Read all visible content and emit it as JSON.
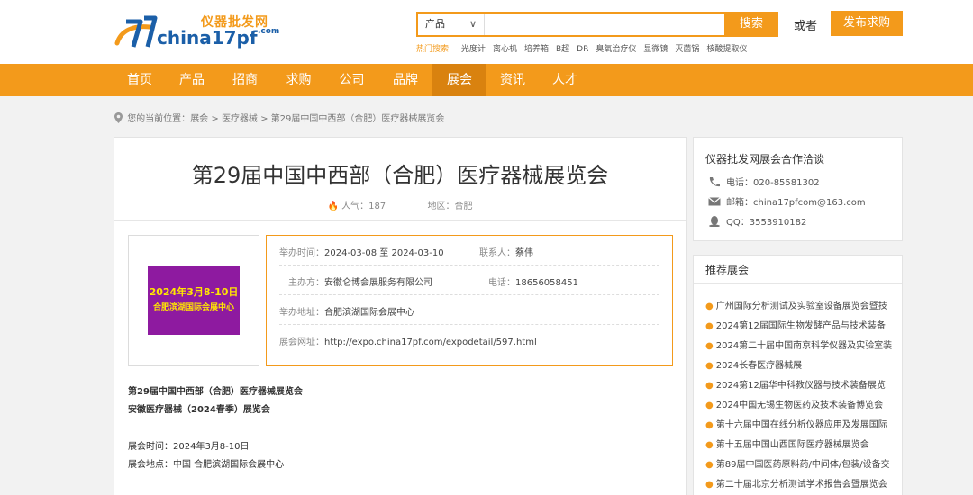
{
  "header": {
    "logo_cn": "仪器批发网",
    "logo_en": "china17pf",
    "logo_en_sub": ".com",
    "search_category": "产品",
    "search_placeholder": "",
    "search_button": "搜索",
    "hot_label": "热门搜索:",
    "hot_items": [
      "光度计",
      "离心机",
      "培养箱",
      "B超",
      "DR",
      "臭氧治疗仪",
      "显微镜",
      "灭菌锅",
      "核酸提取仪"
    ],
    "or_text": "或者",
    "publish_button": "发布求购"
  },
  "nav": {
    "items": [
      "首页",
      "产品",
      "招商",
      "求购",
      "公司",
      "品牌",
      "展会",
      "资讯",
      "人才"
    ],
    "active": "展会"
  },
  "breadcrumb": {
    "label": "您的当前位置：",
    "parts": [
      "展会",
      "医疗器械",
      "第29届中国中西部（合肥）医疗器械展览会"
    ],
    "sep": " > "
  },
  "expo": {
    "title": "第29届中国中西部（合肥）医疗器械展览会",
    "popularity_label": "人气：",
    "popularity": "187",
    "region_label": "地区：",
    "region": "合肥",
    "poster_line1": "2024年3月8-10日",
    "poster_line2": "合肥滨湖国际会展中心",
    "time_label": "举办时间：",
    "time_value": "2024-03-08 至 2024-03-10",
    "contact_label": "联系人：",
    "contact_value": "蔡伟",
    "organizer_label": "主办方：",
    "organizer_value": "安徽仑博会展服务有限公司",
    "phone_label": "电话：",
    "phone_value": "18656058451",
    "address_label": "举办地址：",
    "address_value": "合肥滨湖国际会展中心",
    "url_label": "展会网址：",
    "url_value": "http://expo.china17pf.com/expodetail/597.html",
    "body_title1": "第29届中国中西部（合肥）医疗器械展览会",
    "body_title2": "安徽医疗器械（2024春季）展览会",
    "body_time": "展会时间：2024年3月8-10日",
    "body_place": "展会地点：中国 合肥滨湖国际会展中心"
  },
  "sidebar": {
    "contact_title": "仪器批发网展会合作洽谈",
    "phone": "电话：020-85581302",
    "email": "邮箱：china17pfcom@163.com",
    "qq": "QQ：3553910182",
    "recommend_title": "推荐展会",
    "recommend_items": [
      "广州国际分析测试及实验室设备展览会暨技",
      "2024第12届国际生物发酵产品与技术装备",
      "2024第二十届中国南京科学仪器及实验室装",
      "2024长春医疗器械展",
      "2024第12届华中科教仪器与技术装备展览",
      "2024中国无锡生物医药及技术装备博览会",
      "第十六届中国在线分析仪器应用及发展国际",
      "第十五届中国山西国际医疗器械展览会",
      "第89届中国医药原料药/中间体/包装/设备交",
      "第二十届北京分析测试学术报告会暨展览会"
    ]
  },
  "colors": {
    "accent": "#f39a1b",
    "nav_active": "#d9820f",
    "brand_blue": "#1b5fa8",
    "poster_bg": "#8e1aa0",
    "poster_text": "#ffe600"
  }
}
